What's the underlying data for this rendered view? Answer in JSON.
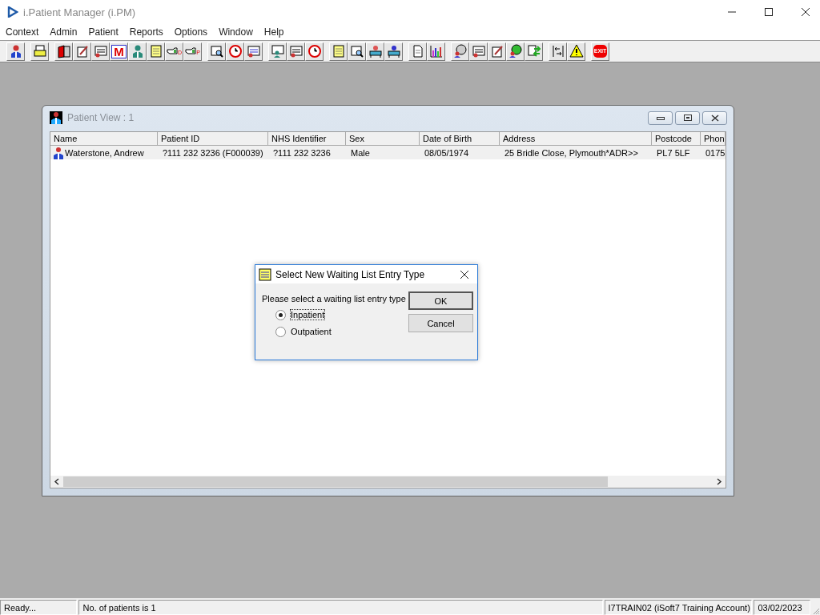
{
  "window": {
    "title": "i.Patient Manager (i.PM)"
  },
  "menu": [
    {
      "label": "Context"
    },
    {
      "label": "Admin"
    },
    {
      "label": "Patient"
    },
    {
      "label": "Reports"
    },
    {
      "label": "Options"
    },
    {
      "label": "Window"
    },
    {
      "label": "Help"
    }
  ],
  "toolbar": [
    [
      {
        "kind": "person"
      }
    ],
    [
      {
        "kind": "printer"
      }
    ],
    [
      {
        "kind": "book"
      },
      {
        "kind": "notepad"
      },
      {
        "kind": "card"
      },
      {
        "kind": "letter",
        "label": "M"
      },
      {
        "kind": "doctor"
      },
      {
        "kind": "note"
      },
      {
        "kind": "hand",
        "label": "D"
      },
      {
        "kind": "hand",
        "label": "P"
      }
    ],
    [
      {
        "kind": "magnifier"
      },
      {
        "kind": "clock"
      },
      {
        "kind": "list"
      }
    ],
    [
      {
        "kind": "monitor"
      },
      {
        "kind": "form"
      },
      {
        "kind": "clockperson"
      }
    ],
    [
      {
        "kind": "sticky"
      },
      {
        "kind": "search"
      },
      {
        "kind": "bed"
      },
      {
        "kind": "bedperson"
      }
    ],
    [
      {
        "kind": "page"
      },
      {
        "kind": "chart"
      }
    ],
    [
      {
        "kind": "disc"
      },
      {
        "kind": "form"
      },
      {
        "kind": "check"
      },
      {
        "kind": "globe"
      },
      {
        "kind": "arrows"
      }
    ],
    [
      {
        "kind": "split"
      },
      {
        "kind": "warning"
      }
    ],
    [
      {
        "kind": "exit",
        "label": "EXIT"
      }
    ]
  ],
  "patient_view": {
    "title": "Patient View : 1",
    "columns": [
      "Name",
      "Patient ID",
      "NHS Identifier",
      "Sex",
      "Date of Birth",
      "Address",
      "Postcode",
      "Phon"
    ],
    "rows": [
      {
        "selected": false,
        "cells": [
          "Waterstone, Andrew",
          "?111 232 3236 (F000039)",
          "?111 232 3236",
          "Male",
          "08/05/1974",
          "25 Bridle Close, Plymouth*ADR>>",
          "PL7 5LF",
          "0175"
        ]
      }
    ]
  },
  "dialog": {
    "title": "Select New Waiting List Entry Type",
    "prompt": "Please select a waiting list entry type",
    "options": [
      {
        "label": "Inpatient",
        "selected": true
      },
      {
        "label": "Outpatient",
        "selected": false
      }
    ],
    "buttons": [
      "OK",
      "Cancel"
    ]
  },
  "status_bar": [
    "Ready...",
    "No. of patients is 1",
    "I7TRAIN02 (iSoft7 Training Account)",
    "03/02/2023"
  ]
}
